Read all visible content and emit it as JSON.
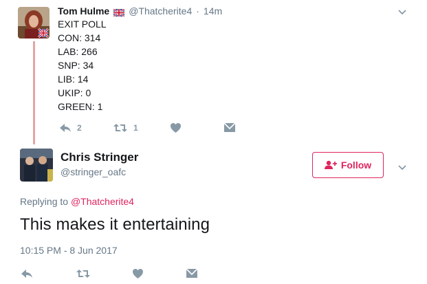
{
  "original_tweet": {
    "author_name": "Tom Hulme",
    "flag_icon": "union-jack-flag-icon",
    "handle": "@Thatcherite4",
    "separator": "·",
    "time_ago": "14m",
    "lines": [
      "EXIT POLL",
      "CON: 314",
      "LAB: 266",
      "SNP: 34",
      "LIB: 14",
      "UKIP: 0",
      "GREEN: 1"
    ],
    "actions": {
      "reply_count": "2",
      "retweet_count": "1"
    }
  },
  "reply_tweet": {
    "author_name": "Chris Stringer",
    "handle": "@stringer_oafc",
    "follow_label": "Follow",
    "replying_prefix": "Replying to",
    "replying_handle": "@Thatcherite4",
    "text": "This makes it entertaining",
    "timestamp": "10:15 PM - 8 Jun 2017"
  },
  "colors": {
    "accent": "#e0245e",
    "muted": "#657786",
    "icon": "#8899a6",
    "thread_line": "#e0a7a3"
  }
}
